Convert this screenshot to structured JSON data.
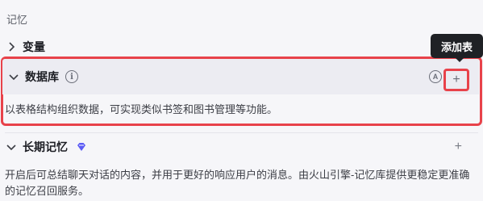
{
  "section": {
    "title": "记忆"
  },
  "variables": {
    "label": "变量"
  },
  "database": {
    "label": "数据库",
    "info_icon": "i",
    "auto_icon": "A",
    "add_symbol": "+",
    "tooltip": "添加表",
    "description": "以表格结构组织数据，可实现类似书签和图书管理等功能。"
  },
  "long_term": {
    "label": "长期记忆",
    "add_symbol": "+",
    "description": "开启后可总结聊天对话的内容，并用于更好的响应用户的消息。由火山引擎-记忆库提供更稳定更准确的记忆召回服务。"
  },
  "colors": {
    "highlight": "#e8424a",
    "premium": "#5b5bf5"
  }
}
